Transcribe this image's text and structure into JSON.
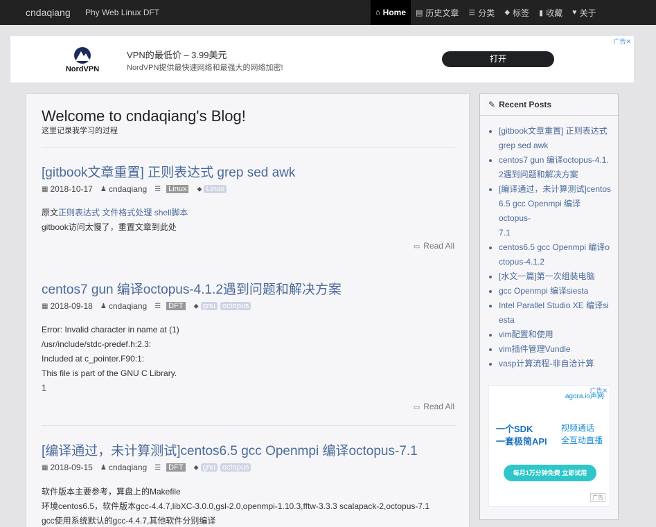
{
  "navbar": {
    "brand": "cndaqiang",
    "subbrand": "Phy Web Linux DFT",
    "items": [
      {
        "label": "Home",
        "icon": "home-icon",
        "glyph": "⌂"
      },
      {
        "label": "历史文章",
        "icon": "archive-icon",
        "glyph": "▤"
      },
      {
        "label": "分类",
        "icon": "list-icon",
        "glyph": "☰"
      },
      {
        "label": "标签",
        "icon": "tags-icon",
        "glyph": "⬥"
      },
      {
        "label": "收藏",
        "icon": "bookmark-icon",
        "glyph": "▮"
      },
      {
        "label": "关于",
        "icon": "heart-icon",
        "glyph": "♥"
      }
    ]
  },
  "top_ad": {
    "logo_name": "NordVPN",
    "title": "VPN的最低价 – 3.99美元",
    "desc": "NordVPN提供最快速网络和最强大的网络加密!",
    "button": "打开",
    "tag": "广告✕"
  },
  "main": {
    "welcome": "Welcome to cndaqiang's Blog!",
    "subtitle": "这里记录我学习的过程",
    "read_all": "Read All",
    "posts": [
      {
        "title": "[gitbook文章重置] 正则表达式 grep sed awk",
        "date": "2018-10-17",
        "author": "cndaqiang",
        "category": "Linux",
        "tags": [
          "Linux"
        ],
        "lines": [
          "gitbook访问太慢了，重置文章到此处"
        ],
        "prefix": "原文",
        "links": [
          "正则表达式",
          "文件格式处理",
          "shell脚本"
        ]
      },
      {
        "title": "centos7 gun 编译octopus-4.1.2遇到问题和解决方案",
        "date": "2018-09-18",
        "author": "cndaqiang",
        "category": "DFT",
        "tags": [
          "gnu",
          "octopus"
        ],
        "lines": [
          "Error: Invalid character in name at (1)",
          "/usr/include/stdc-predef.h:2.3:",
          "Included at c_pointer.F90:1:",
          "This file is part of the GNU C Library.",
          "1"
        ]
      },
      {
        "title": "[编译通过，未计算测试]centos6.5 gcc Openmpi 编译octopus-7.1",
        "date": "2018-09-15",
        "author": "cndaqiang",
        "category": "DFT",
        "tags": [
          "gnu",
          "octopus"
        ],
        "lines": [
          "软件版本主要参考，算盘上的Makefile",
          "环境centos6.5，软件版本gcc-4.4.7,libXC-3.0.0,gsl-2.0,openmpi-1.10.3,fftw-3.3.3 scalapack-2,octopus-7.1",
          "gcc使用系统默认的gcc-4.4.7,其他软件分别编译"
        ]
      }
    ]
  },
  "sidebar": {
    "heading": "Recent Posts",
    "items": [
      [
        "[gitbook文章重置] 正则表达式",
        "grep sed awk"
      ],
      [
        "centos7 gun 编译octopus-4.1.",
        "2遇到问题和解决方案"
      ],
      [
        "[编译通过，未计算测试]centos",
        "6.5 gcc Openmpi 编译octopus-",
        "7.1"
      ],
      [
        "centos6.5 gcc Openmpi 编译o",
        "ctopus-4.1.2"
      ],
      [
        "[水文一篇]第一次组装电脑"
      ],
      [
        "gcc Openmpi 编译siesta"
      ],
      [
        "Intel Parallel Studio XE 编译si",
        "esta"
      ],
      [
        "vim配置和使用"
      ],
      [
        "vim插件管理Vundle"
      ],
      [
        "vasp计算流程-非自洽计算"
      ]
    ],
    "ad": {
      "logo": "agora.io声网",
      "line1": "一个SDK",
      "line2": "一套极简API",
      "line3": "视频通话",
      "line4": "全互动直播",
      "button": "每月1万分钟免费  立即试用",
      "tag": "广告✕",
      "tag2": "广告"
    }
  },
  "colors": {
    "link": "#4a6a9a",
    "navbar": "#222222",
    "category_badge": "#999999",
    "tag_badge": "#cfd4e4"
  }
}
